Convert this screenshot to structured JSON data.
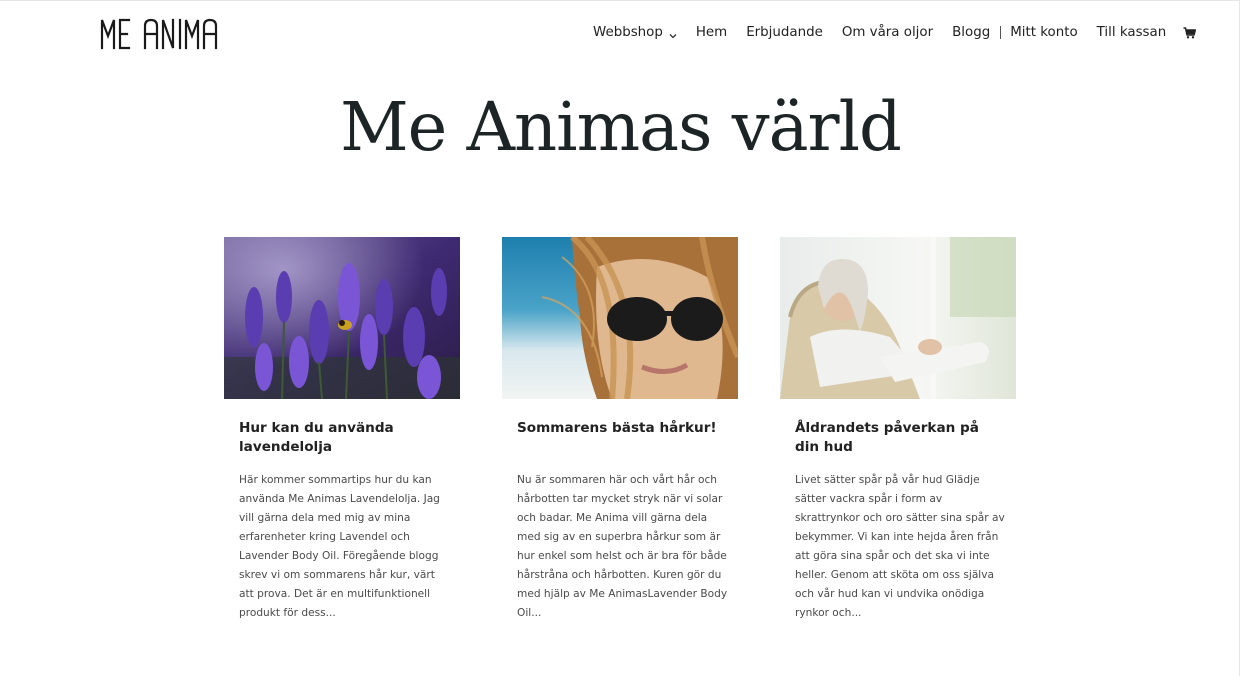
{
  "brand": {
    "logo_text": "ME ANIMA"
  },
  "nav": {
    "items": [
      {
        "label": "Webbshop",
        "has_dropdown": true
      },
      {
        "label": "Hem"
      },
      {
        "label": "Erbjudande"
      },
      {
        "label": "Om våra oljor"
      },
      {
        "label": "Blogg"
      },
      {
        "label": "Mitt konto"
      },
      {
        "label": "Till kassan"
      }
    ],
    "cart_icon": "shopping-cart-icon",
    "dropdown_icon": "chevron-down-icon"
  },
  "hero": {
    "title": "Me Animas värld"
  },
  "posts": [
    {
      "image": "lavender-field-with-bee",
      "title": "Hur kan du använda lavendelolja",
      "excerpt": "Här kommer sommartips hur du kan använda Me Animas Lavendelolja. Jag vill gärna dela med mig av mina erfarenheter kring Lavendel och Lavender Body Oil. Föregående blogg skrev vi om sommarens hår kur, värt att prova. Det är en multifunktionell produkt för dess..."
    },
    {
      "image": "woman-with-sunglasses-windswept-hair",
      "title": "Sommarens bästa hårkur!",
      "excerpt": "Nu är sommaren här och vårt hår och hårbotten tar mycket stryk när vi solar och badar. Me Anima vill gärna dela med sig av en superbra hårkur som är hur enkel som helst och är bra för både hårstråna och hårbotten. Kuren gör du med hjälp av Me AnimasLavender Body Oil..."
    },
    {
      "image": "smiling-older-woman-in-chair",
      "title": "Åldrandets påverkan på din hud",
      "excerpt": "Livet sätter spår på vår hud Glädje sätter vackra spår i form av skrattrynkor och oro sätter sina spår av bekymmer. Vi kan inte hejda åren från att göra sina spår och det ska vi inte heller. Genom att sköta om oss själva och vår hud kan vi undvika onödiga rynkor och..."
    }
  ],
  "colors": {
    "text_dark": "#1c2426",
    "nav_text": "#222222",
    "body_text": "#4a4a4a"
  }
}
